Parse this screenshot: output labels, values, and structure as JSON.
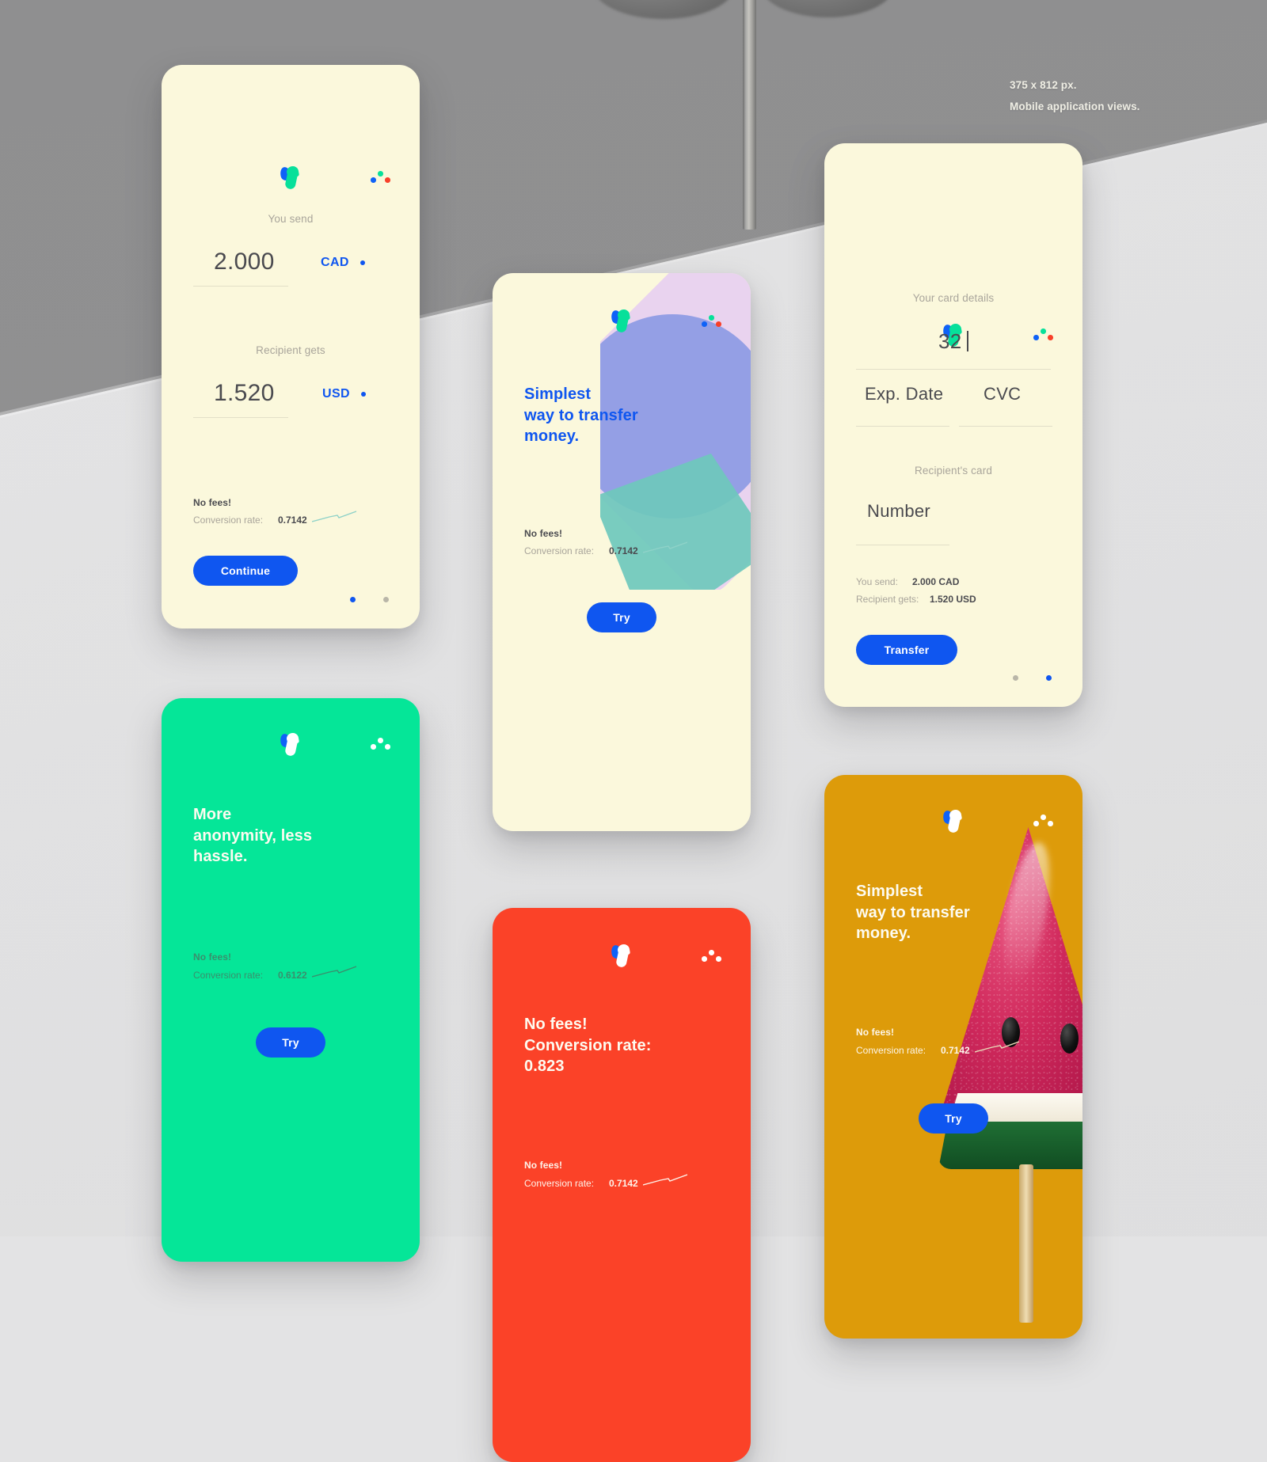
{
  "caption": {
    "line1": "375 x 812 px.",
    "line2": "Mobile application views."
  },
  "colors": {
    "brand_blue": "#0f56f0",
    "brand_green": "#07e09a",
    "brand_red": "#f8402a",
    "cream": "#fbf8dc",
    "screen_green": "#05e698",
    "screen_red": "#fb4228",
    "screen_orange": "#dd9b0a",
    "muted_text": "#a9a59b",
    "dark_text": "#4a4a4f",
    "backdrop_dark": "#8f8f90",
    "backdrop_light": "#e3e3e4"
  },
  "screens": [
    {
      "id": "send-money",
      "send_label": "You send",
      "send_amount": "2.000",
      "send_currency": "CAD",
      "receive_label": "Recipient gets",
      "receive_amount": "1.520",
      "receive_currency": "USD",
      "no_fees": "No fees!",
      "rate_label": "Conversion rate:",
      "rate_value": "0.7142",
      "button": "Continue",
      "pager": [
        "active",
        "inactive"
      ]
    },
    {
      "id": "onboarding-transfer",
      "headline": "Simplest\nway to transfer\nmoney.",
      "no_fees": "No fees!",
      "rate_label": "Conversion rate:",
      "rate_value": "0.7142",
      "button": "Try"
    },
    {
      "id": "card-details",
      "card_label": "Your card details",
      "card_number": "32",
      "exp_placeholder": "Exp. Date",
      "cvc_placeholder": "CVC",
      "recipient_label": "Recipient's card",
      "number_placeholder": "Number",
      "summary": [
        {
          "label": "You send:",
          "value": "2.000 CAD"
        },
        {
          "label": "Recipient gets:",
          "value": "1.520 USD"
        }
      ],
      "button": "Transfer",
      "pager": [
        "inactive",
        "active"
      ]
    },
    {
      "id": "onboarding-anonymity",
      "headline": "More\nanonymity, less\nhassle.",
      "no_fees": "No fees!",
      "rate_label": "Conversion rate:",
      "rate_value": "0.6122",
      "button": "Try"
    },
    {
      "id": "onboarding-no-fees",
      "headline": "No fees!\nConversion rate:\n0.823",
      "no_fees": "No fees!",
      "rate_label": "Conversion rate:",
      "rate_value": "0.7142"
    },
    {
      "id": "onboarding-popsicle",
      "headline": "Simplest\nway to transfer\nmoney.",
      "no_fees": "No fees!",
      "rate_label": "Conversion rate:",
      "rate_value": "0.7142",
      "button": "Try"
    }
  ]
}
